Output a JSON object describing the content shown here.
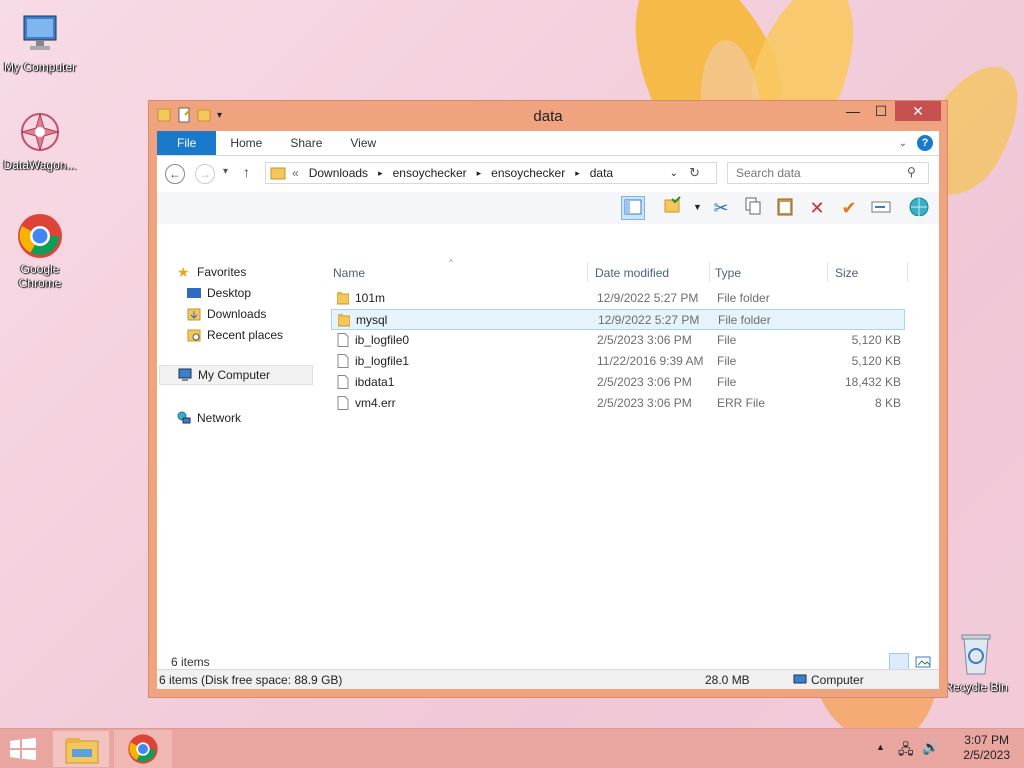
{
  "desktop": {
    "icons": [
      {
        "label": "My Computer"
      },
      {
        "label": "DataWagon..."
      },
      {
        "label": "Google Chrome"
      },
      {
        "label": "Recycle Bin"
      }
    ]
  },
  "window": {
    "title": "data",
    "buttons": {
      "minimize": "—",
      "maximize": "☐",
      "close": "✕"
    },
    "ribbon_tabs": [
      "File",
      "Home",
      "Share",
      "View"
    ],
    "help": "?",
    "address": {
      "prefix": "«",
      "path": [
        "Downloads",
        "ensoychecker",
        "ensoychecker",
        "data"
      ]
    },
    "search": {
      "placeholder": "Search data"
    },
    "nav": {
      "favorites": "Favorites",
      "items": [
        "Desktop",
        "Downloads",
        "Recent places"
      ],
      "my_computer": "My Computer",
      "network": "Network"
    },
    "columns": {
      "name": "Name",
      "date": "Date modified",
      "type": "Type",
      "size": "Size"
    },
    "files": [
      {
        "name": "101m",
        "date": "12/9/2022 5:27 PM",
        "type": "File folder",
        "size": "",
        "kind": "folder"
      },
      {
        "name": "mysql",
        "date": "12/9/2022 5:27 PM",
        "type": "File folder",
        "size": "",
        "kind": "folder",
        "selected": true
      },
      {
        "name": "ib_logfile0",
        "date": "2/5/2023 3:06 PM",
        "type": "File",
        "size": "5,120 KB",
        "kind": "file"
      },
      {
        "name": "ib_logfile1",
        "date": "11/22/2016 9:39 AM",
        "type": "File",
        "size": "5,120 KB",
        "kind": "file"
      },
      {
        "name": "ibdata1",
        "date": "2/5/2023 3:06 PM",
        "type": "File",
        "size": "18,432 KB",
        "kind": "file"
      },
      {
        "name": "vm4.err",
        "date": "2/5/2023 3:06 PM",
        "type": "ERR File",
        "size": "8 KB",
        "kind": "file"
      }
    ],
    "item_count": "6 items",
    "statusbar": {
      "left": "6 items (Disk free space: 88.9 GB)",
      "size": "28.0 MB",
      "location": "Computer"
    }
  },
  "taskbar": {
    "time": "3:07 PM",
    "date": "2/5/2023"
  },
  "colors": {
    "window_frame": "#f0a37f",
    "accent": "#1979ca",
    "close": "#c75050",
    "taskbar": "#e9a5a0"
  }
}
